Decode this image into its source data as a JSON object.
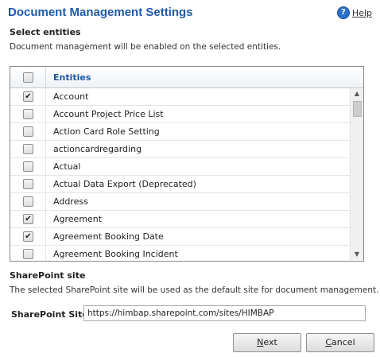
{
  "header": {
    "title": "Document Management Settings",
    "help_label": "Help",
    "help_icon": "question-icon",
    "help_glyph": "?"
  },
  "entities_section": {
    "heading": "Select entities",
    "description": "Document management will be enabled on the selected entities.",
    "column_header": "Entities",
    "rows": [
      {
        "label": "Account",
        "checked": true
      },
      {
        "label": "Account Project Price List",
        "checked": false
      },
      {
        "label": "Action Card Role Setting",
        "checked": false
      },
      {
        "label": "actioncardregarding",
        "checked": false
      },
      {
        "label": "Actual",
        "checked": false
      },
      {
        "label": "Actual Data Export (Deprecated)",
        "checked": false
      },
      {
        "label": "Address",
        "checked": false
      },
      {
        "label": "Agreement",
        "checked": true
      },
      {
        "label": "Agreement Booking Date",
        "checked": true
      },
      {
        "label": "Agreement Booking Incident",
        "checked": false
      },
      {
        "label": "",
        "checked": false
      }
    ],
    "check_glyph": "✔"
  },
  "sharepoint_section": {
    "heading": "SharePoint site",
    "description": "The selected SharePoint site will be used as the default site for document management.",
    "field_label": "SharePoint Site:",
    "field_value": "https://himbap.sharepoint.com/sites/HIMBAP"
  },
  "buttons": {
    "next_first": "N",
    "next_rest": "ext",
    "cancel_first": "C",
    "cancel_rest": "ancel"
  },
  "scrollbar": {
    "up_glyph": "▲",
    "down_glyph": "▼"
  },
  "colors": {
    "title": "#1e5aa8",
    "help_icon": "#2a6fc9"
  }
}
